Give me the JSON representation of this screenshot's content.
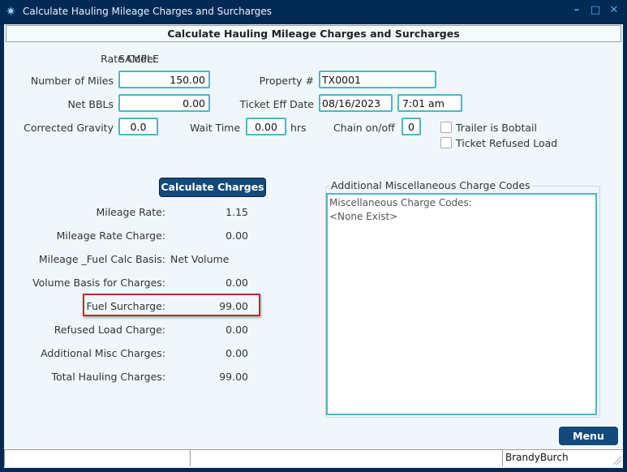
{
  "window": {
    "title": "Calculate Hauling Mileage Charges and Surcharges",
    "app_icon": "app-logo-icon",
    "controls": {
      "minimize": "–",
      "maximize": "□",
      "close": "✕"
    }
  },
  "header": {
    "title": "Calculate Hauling Mileage Charges and Surcharges"
  },
  "form": {
    "rate_code_label": "Rate Code:",
    "rate_code_value": "SAMPLE",
    "miles_label": "Number of Miles",
    "miles_value": "150.00",
    "net_bbls_label": "Net BBLs",
    "net_bbls_value": "0.00",
    "gravity_label": "Corrected Gravity",
    "gravity_value": "0.0",
    "wait_time_label": "Wait Time",
    "wait_time_value": "0.00",
    "wait_time_unit": "hrs",
    "property_label": "Property #",
    "property_value": "TX0001",
    "ticket_date_label": "Ticket Eff Date",
    "ticket_date_value": "08/16/2023",
    "ticket_time_value": "7:01 am",
    "chain_label": "Chain on/off",
    "chain_value": "0",
    "bobtail_label": "Trailer is Bobtail",
    "bobtail_checked": false,
    "refused_label": "Ticket Refused Load",
    "refused_checked": false
  },
  "calculate_button": "Calculate Charges",
  "results": [
    {
      "label": "Mileage Rate:",
      "value": "1.15"
    },
    {
      "label": "Mileage Rate Charge:",
      "value": "0.00"
    },
    {
      "label": "Mileage _Fuel Calc Basis:",
      "value": "Net Volume"
    },
    {
      "label": "Volume Basis for Charges:",
      "value": "0.00"
    },
    {
      "label": "Fuel Surcharge:",
      "value": "99.00"
    },
    {
      "label": "Refused Load Charge:",
      "value": "0.00"
    },
    {
      "label": "Additional Misc Charges:",
      "value": "0.00"
    },
    {
      "label": "Total Hauling Charges:",
      "value": "99.00"
    }
  ],
  "misc_group": {
    "legend": "Additional Miscellaneous Charge Codes",
    "line1": "Miscellaneous Charge Codes:",
    "line2": "<None Exist>"
  },
  "menu_button": "Menu",
  "statusbar": {
    "panel1": "",
    "panel2": "",
    "user": "BrandyBurch"
  },
  "colors": {
    "accent": "#4bb8c0",
    "button": "#134a7c",
    "titlebar": "#022a54",
    "highlight": "#c0282c"
  }
}
